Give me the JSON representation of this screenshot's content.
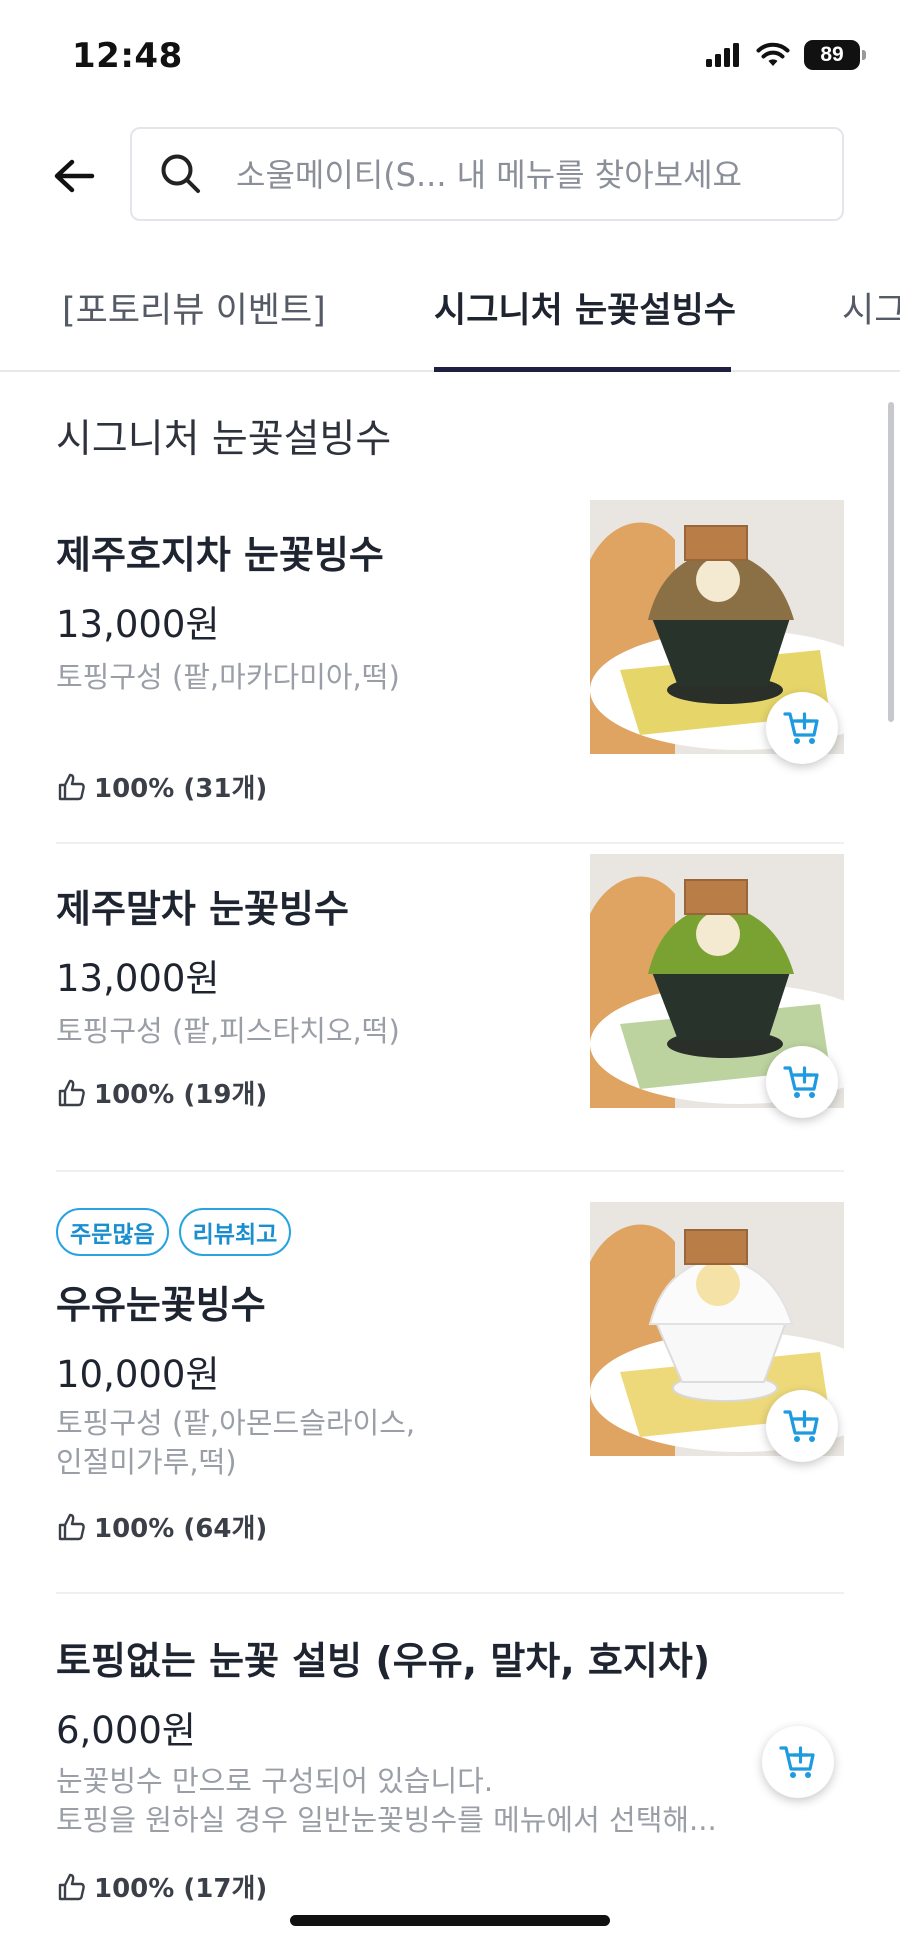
{
  "status_bar": {
    "time": "12:48",
    "battery": "89"
  },
  "search": {
    "placeholder": "소울메이티(S... 내 메뉴를 찾아보세요"
  },
  "tabs": [
    {
      "label": "[포토리뷰 이벤트]",
      "active": false
    },
    {
      "label": "시그니처 눈꽃설빙수",
      "active": true
    },
    {
      "label": "시그",
      "active": false
    }
  ],
  "section": {
    "title": "시그니처 눈꽃설빙수"
  },
  "items": [
    {
      "name": "제주호지차 눈꽃빙수",
      "price": "13,000원",
      "description": "토핑구성 (팥,마카다미아,떡)",
      "rating": "100% (31개)",
      "badges": [],
      "image": "hojicha-bingsu"
    },
    {
      "name": "제주말차 눈꽃빙수",
      "price": "13,000원",
      "description": "토핑구성 (팥,피스타치오,떡)",
      "rating": "100% (19개)",
      "badges": [],
      "image": "matcha-bingsu"
    },
    {
      "name": "우유눈꽃빙수",
      "price": "10,000원",
      "description": "토핑구성 (팥,아몬드슬라이스,\n인절미가루,떡)",
      "rating": "100% (64개)",
      "badges": [
        "주문많음",
        "리뷰최고"
      ],
      "image": "milk-bingsu"
    },
    {
      "name": "토핑없는 눈꽃 설빙 (우유, 말차, 호지차)",
      "price": "6,000원",
      "description": "눈꽃빙수 만으로 구성되어 있습니다.\n토핑을 원하실 경우 일반눈꽃빙수를 메뉴에서 선택해...",
      "rating": "100% (17개)",
      "badges": [],
      "image": null
    }
  ],
  "colors": {
    "accent": "#1a8fcf",
    "cart": "#1e9be0",
    "tab_indicator": "#1f2040",
    "text": "#1f2431",
    "muted": "#9a9ea6"
  }
}
